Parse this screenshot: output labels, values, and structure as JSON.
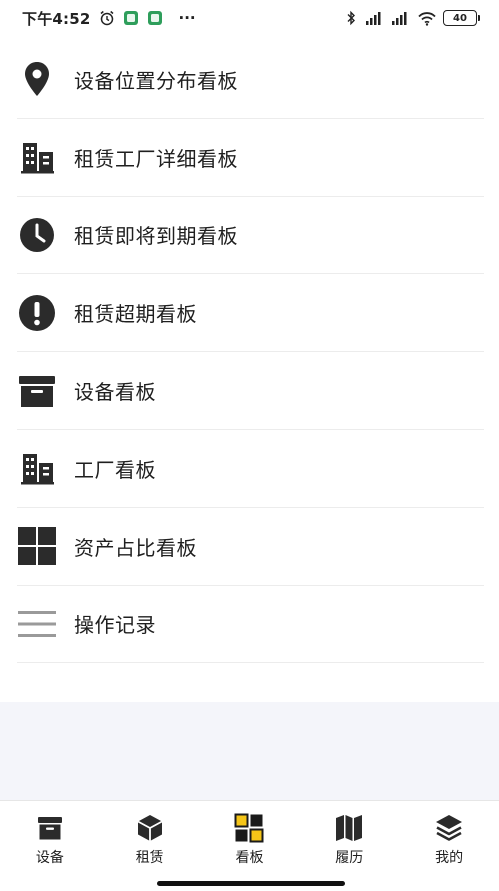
{
  "status_bar": {
    "time": "下午4:52",
    "extra": "···",
    "battery": "40"
  },
  "menu": {
    "items": [
      {
        "label": "设备位置分布看板",
        "icon": "location-pin-icon"
      },
      {
        "label": "租赁工厂详细看板",
        "icon": "buildings-icon"
      },
      {
        "label": "租赁即将到期看板",
        "icon": "clock-icon"
      },
      {
        "label": "租赁超期看板",
        "icon": "exclamation-icon"
      },
      {
        "label": "设备看板",
        "icon": "archive-box-icon"
      },
      {
        "label": "工厂看板",
        "icon": "buildings-icon"
      },
      {
        "label": "资产占比看板",
        "icon": "grid-icon"
      },
      {
        "label": "操作记录",
        "icon": "list-lines-icon"
      }
    ]
  },
  "tabs": [
    {
      "label": "设备",
      "icon": "archive-box-icon",
      "active": false
    },
    {
      "label": "租赁",
      "icon": "cube-icon",
      "active": false
    },
    {
      "label": "看板",
      "icon": "dashboard-grid-icon",
      "active": true
    },
    {
      "label": "履历",
      "icon": "map-icon",
      "active": false
    },
    {
      "label": "我的",
      "icon": "layers-icon",
      "active": false
    }
  ],
  "colors": {
    "icon_dark": "#2b2b2b",
    "accent_yellow": "#f5c518",
    "gray_area": "#f4f5fa"
  }
}
